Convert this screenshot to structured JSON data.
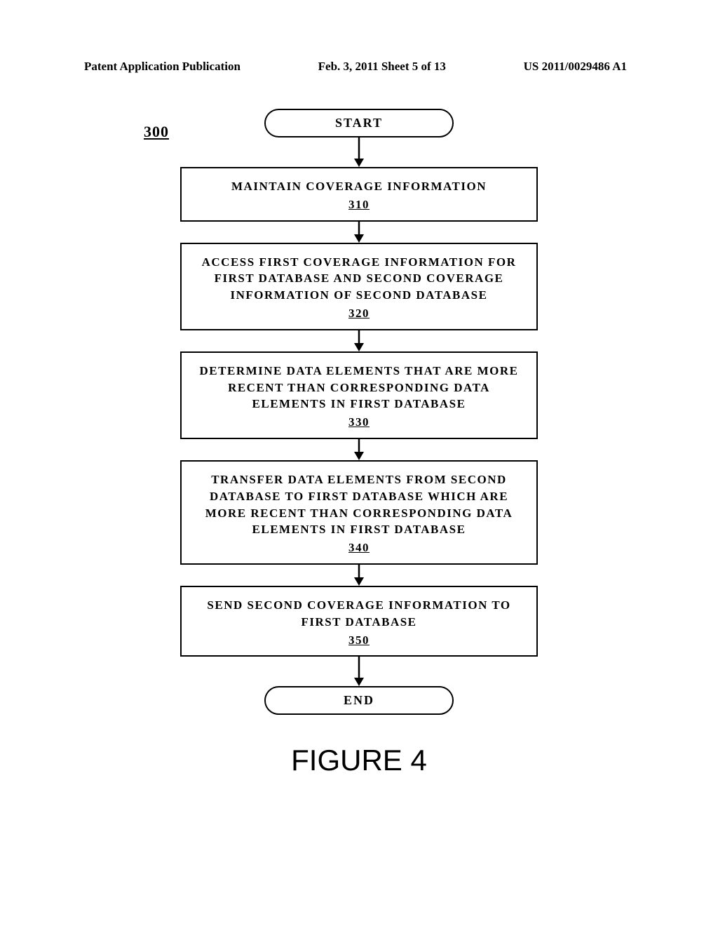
{
  "header": {
    "left": "Patent Application Publication",
    "center": "Feb. 3, 2011  Sheet 5 of 13",
    "right": "US 2011/0029486 A1"
  },
  "ref_label": "300",
  "terminal_start": "START",
  "terminal_end": "END",
  "steps": {
    "s310": {
      "text": "MAINTAIN COVERAGE INFORMATION",
      "num": "310"
    },
    "s320": {
      "text": "ACCESS FIRST COVERAGE INFORMATION FOR FIRST DATABASE AND SECOND COVERAGE INFORMATION OF SECOND DATABASE",
      "num": "320"
    },
    "s330": {
      "text": "DETERMINE DATA ELEMENTS THAT ARE MORE RECENT THAN CORRESPONDING DATA ELEMENTS IN FIRST DATABASE",
      "num": "330"
    },
    "s340": {
      "text": "TRANSFER DATA ELEMENTS FROM SECOND DATABASE TO FIRST DATABASE WHICH ARE MORE RECENT THAN CORRESPONDING DATA ELEMENTS IN FIRST DATABASE",
      "num": "340"
    },
    "s350": {
      "text": "SEND SECOND COVERAGE INFORMATION TO FIRST DATABASE",
      "num": "350"
    }
  },
  "figure_label": "FIGURE 4"
}
